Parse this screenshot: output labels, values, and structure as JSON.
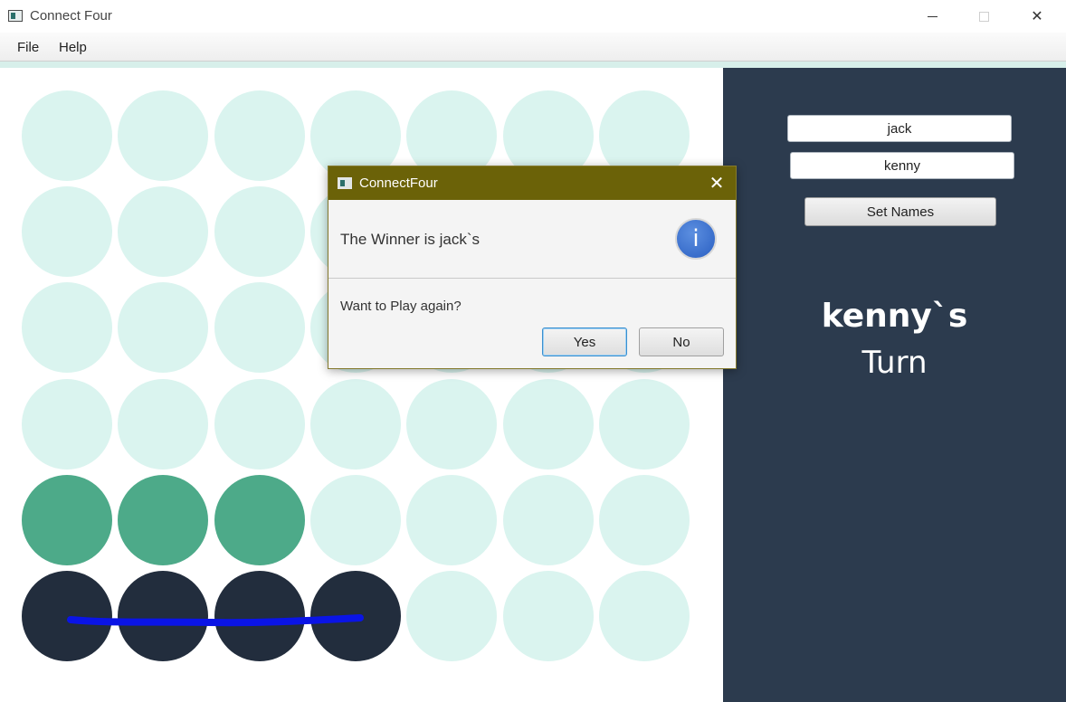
{
  "window": {
    "title": "Connect Four",
    "controls": {
      "minimize": "minimize",
      "maximize": "maximize",
      "close": "✕"
    }
  },
  "menu": {
    "items": [
      "File",
      "Help"
    ]
  },
  "colors": {
    "empty": "#daf4ef",
    "player_dark": "#222d3d",
    "player_green": "#4daa89",
    "win_line": "#0a14e6",
    "side_panel": "#2c3b4e"
  },
  "board": {
    "columns": 7,
    "rows": 6,
    "cells": [
      [
        "empty",
        "empty",
        "empty",
        "empty",
        "empty",
        "empty",
        "empty"
      ],
      [
        "empty",
        "empty",
        "empty",
        "empty",
        "empty",
        "empty",
        "empty"
      ],
      [
        "empty",
        "empty",
        "empty",
        "empty",
        "empty",
        "empty",
        "empty"
      ],
      [
        "empty",
        "empty",
        "empty",
        "empty",
        "empty",
        "empty",
        "empty"
      ],
      [
        "green",
        "green",
        "green",
        "empty",
        "empty",
        "empty",
        "empty"
      ],
      [
        "dark",
        "dark",
        "dark",
        "dark",
        "empty",
        "empty",
        "empty"
      ]
    ]
  },
  "side_panel": {
    "player1_name": "jack",
    "player2_name": "kenny",
    "set_names_label": "Set Names",
    "current_player": "kenny`s",
    "turn_label": "Turn"
  },
  "dialog": {
    "title": "ConnectFour",
    "close_label": "✕",
    "headline": "The Winner is jack`s",
    "icon": "info-icon",
    "content": "Want to Play again?",
    "yes_label": "Yes",
    "no_label": "No"
  }
}
